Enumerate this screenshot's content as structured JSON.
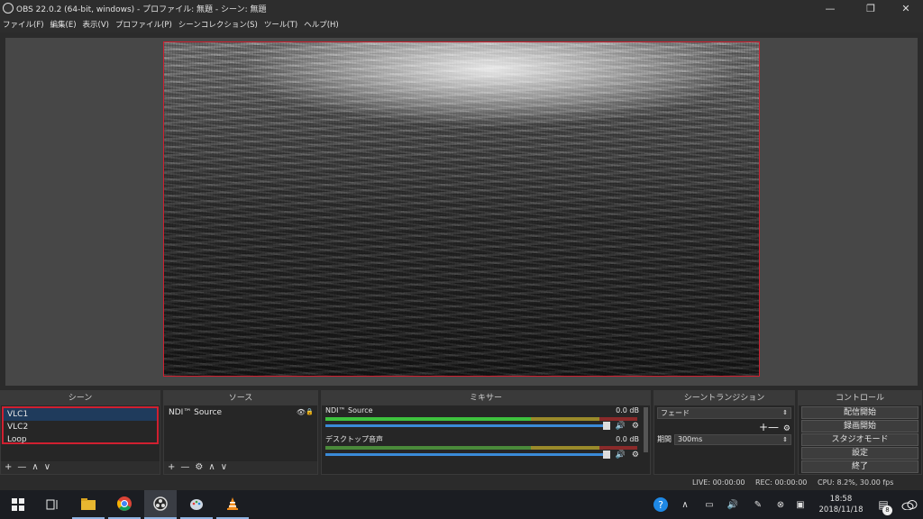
{
  "window": {
    "title": "OBS 22.0.2 (64-bit, windows) - プロファイル: 無題 - シーン: 無題",
    "minimize": "—",
    "maximize": "❐",
    "close": "✕"
  },
  "menu": [
    "ファイル(F)",
    "編集(E)",
    "表示(V)",
    "プロファイル(P)",
    "シーンコレクション(S)",
    "ツール(T)",
    "ヘルプ(H)"
  ],
  "docks": {
    "scenes": {
      "title": "シーン",
      "items": [
        "VLC1",
        "VLC2",
        "Loop"
      ],
      "selected_index": 0,
      "footer": [
        "+",
        "—",
        "∧",
        "∨"
      ]
    },
    "sources": {
      "title": "ソース",
      "items": [
        "NDI™ Source"
      ],
      "footer": [
        "+",
        "—",
        "⚙",
        "∧",
        "∨"
      ]
    },
    "mixer": {
      "title": "ミキサー",
      "tracks": [
        {
          "name": "NDI™ Source",
          "db": "0.0 dB",
          "active": true
        },
        {
          "name": "デスクトップ音声",
          "db": "0.0 dB",
          "active": false
        }
      ]
    },
    "transitions": {
      "title": "シーントランジション",
      "selected": "フェード",
      "duration_label": "期間",
      "duration_value": "300ms",
      "add_remove": "+—"
    },
    "controls": {
      "title": "コントロール",
      "buttons": [
        "配信開始",
        "録画開始",
        "スタジオモード",
        "設定",
        "終了"
      ]
    }
  },
  "status": {
    "live": "LIVE: 00:00:00",
    "rec": "REC: 00:00:00",
    "cpu": "CPU: 8.2%, 30.00 fps"
  },
  "taskbar": {
    "clock_time": "18:58",
    "clock_date": "2018/11/18",
    "notification_count": "8"
  },
  "colors": {
    "selection_border": "#d02030",
    "selected_row": "#1f3b5c",
    "fader": "#3a8ad8"
  }
}
